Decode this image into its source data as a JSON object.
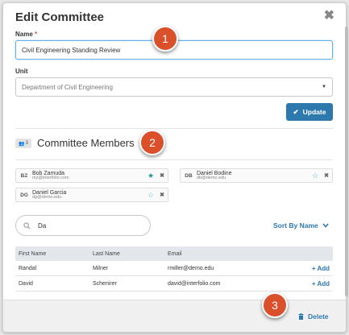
{
  "dialog": {
    "title": "Edit Committee"
  },
  "name_field": {
    "label": "Name",
    "required_mark": "*",
    "value": "Civil Engineering Standing Review"
  },
  "unit_field": {
    "label": "Unit",
    "value": "Department of Civil Engineering"
  },
  "update_button": {
    "label": "Update"
  },
  "members_section": {
    "count": "3",
    "title": "Committee Members"
  },
  "members": [
    {
      "initials": "BZ",
      "name": "Bob Zamuda",
      "email": "mz@interfolio.com",
      "starred": true
    },
    {
      "initials": "DB",
      "name": "Daniel Bodine",
      "email": "db@demo.edu",
      "starred": false
    },
    {
      "initials": "DG",
      "name": "Daniel Garcia",
      "email": "dg@demo.edu",
      "starred": false
    }
  ],
  "search": {
    "value": "Da"
  },
  "sort": {
    "label": "Sort By Name"
  },
  "table": {
    "headers": [
      "First Name",
      "Last Name",
      "Email"
    ],
    "add_label": "Add",
    "rows": [
      {
        "first": "Randal",
        "last": "Milner",
        "email": "rmiller@demo.edu"
      },
      {
        "first": "David",
        "last": "Schenirer",
        "email": "david@interfolio.com"
      }
    ]
  },
  "footer": {
    "delete_label": "Delete"
  },
  "callouts": [
    "1",
    "2",
    "3"
  ],
  "colors": {
    "accent": "#2d79ad",
    "callout": "#d9502b",
    "star": "#1a9b8a"
  }
}
